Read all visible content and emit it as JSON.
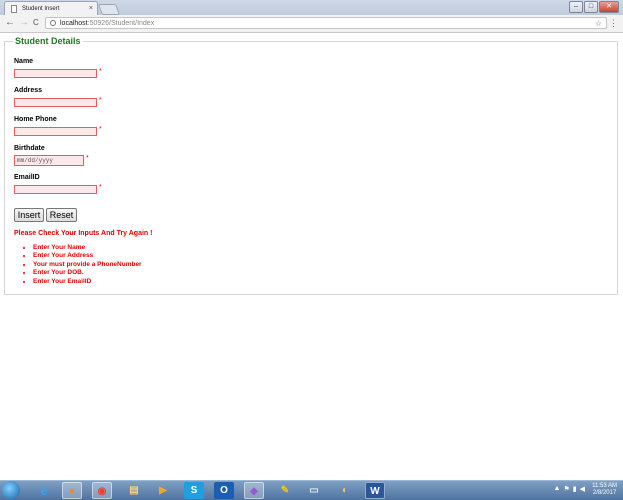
{
  "browser": {
    "tab_title": "Student Insert",
    "tab_close": "×",
    "window_controls": {
      "minimize": "–",
      "maximize": "□",
      "close": "✕"
    },
    "back": "←",
    "forward": "→",
    "reload": "C",
    "url_host": "localhost",
    "url_path": ":50926/Student/Index",
    "star_icon": "☆",
    "menu_icon": "⋮"
  },
  "form": {
    "legend": "Student Details",
    "required_marker": "*",
    "fields": [
      {
        "label": "Name",
        "value": ""
      },
      {
        "label": "Address",
        "value": ""
      },
      {
        "label": "Home Phone",
        "value": ""
      },
      {
        "label": "Birthdate",
        "placeholder": "mm/dd/yyyy"
      },
      {
        "label": "EmailID",
        "value": ""
      }
    ],
    "insert_button": "Insert",
    "reset_button": "Reset",
    "validation_title": "Please Check Your Inputs And Try Again !",
    "validation_errors": [
      "Enter Your Name",
      "Enter Your Address",
      "Your must provide a PhoneNumber",
      "Enter Your DOB.",
      "Enter Your EmailID"
    ]
  },
  "taskbar": {
    "apps": [
      "internet-explorer",
      "firefox",
      "chrome",
      "file-explorer",
      "media-player",
      "skype",
      "outlook",
      "visual-studio",
      "tools",
      "notepad",
      "paint",
      "word"
    ],
    "app_glyphs": {
      "internet-explorer": "e",
      "firefox": "●",
      "chrome": "◉",
      "file-explorer": "▤",
      "media-player": "▶",
      "skype": "S",
      "outlook": "O",
      "visual-studio": "◆",
      "tools": "✎",
      "notepad": "▭",
      "paint": "◐",
      "word": "W"
    },
    "time": "11:53 AM",
    "date": "2/8/2017"
  },
  "colors": {
    "legend_green": "#1d7a1d",
    "error_red": "#e00000",
    "invalid_input_border": "#e06060"
  }
}
